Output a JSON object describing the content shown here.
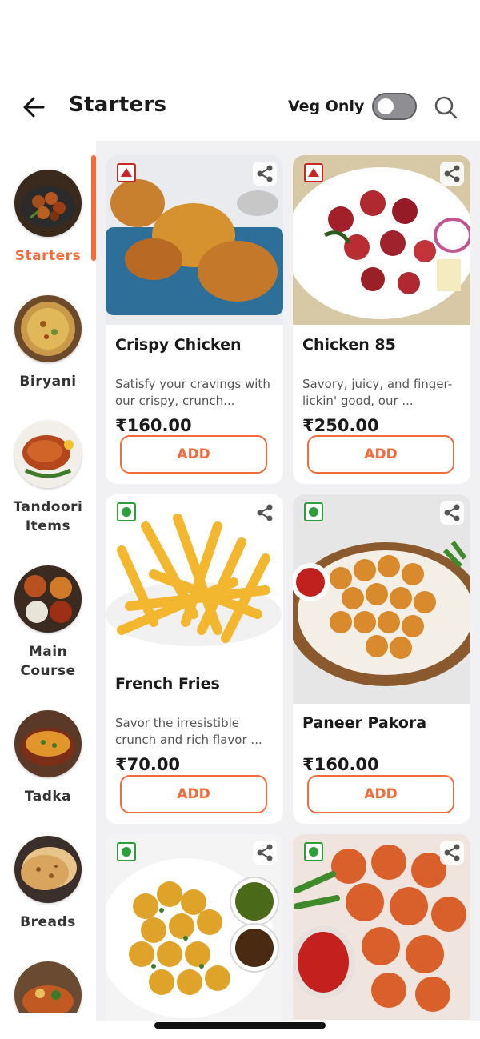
{
  "header": {
    "title": "Starters",
    "veg_only_label": "Veg Only",
    "veg_only_enabled": false,
    "back_icon": "arrow-left-icon",
    "search_icon": "search-icon"
  },
  "colors": {
    "accent": "#f26b3a",
    "veg": "#2e9e3a",
    "nonveg": "#c62828"
  },
  "sidebar": {
    "items": [
      {
        "label": "Starters",
        "active": true
      },
      {
        "label": "Biryani",
        "active": false
      },
      {
        "label": "Tandoori Items",
        "active": false
      },
      {
        "label": "Main Course",
        "active": false
      },
      {
        "label": "Tadka",
        "active": false
      },
      {
        "label": "Breads",
        "active": false
      }
    ]
  },
  "products": [
    {
      "name": "Crispy Chicken",
      "desc": "Satisfy your cravings with our crispy, crunch...",
      "price": "₹160.00",
      "type": "non-veg",
      "add_label": "ADD"
    },
    {
      "name": "Chicken 85",
      "desc": "Savory, juicy, and finger-lickin' good, our ...",
      "price": "₹250.00",
      "type": "non-veg",
      "add_label": "ADD"
    },
    {
      "name": "French Fries",
      "desc": "Savor the irresistible crunch and rich flavor ...",
      "price": "₹70.00",
      "type": "veg",
      "add_label": "ADD"
    },
    {
      "name": "Paneer Pakora",
      "desc": "",
      "price": "₹160.00",
      "type": "veg",
      "add_label": "ADD"
    },
    {
      "name": "",
      "desc": "",
      "price": "",
      "type": "veg",
      "add_label": ""
    },
    {
      "name": "",
      "desc": "",
      "price": "",
      "type": "veg",
      "add_label": ""
    }
  ]
}
